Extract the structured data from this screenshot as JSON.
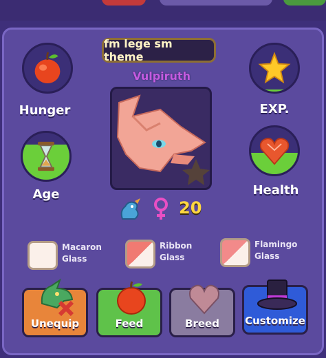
{
  "header": {
    "title": "fm lege sm theme"
  },
  "pet": {
    "name": "Vulpiruth",
    "age_value": "20"
  },
  "stats": {
    "hunger": {
      "label": "Hunger",
      "icon": "apple-icon",
      "level": 0
    },
    "exp": {
      "label": "EXP.",
      "icon": "star-icon",
      "level": 0.05
    },
    "age": {
      "label": "Age",
      "icon": "hourglass-icon",
      "level": 0.75
    },
    "health": {
      "label": "Health",
      "icon": "heart-icon",
      "level": 0.45
    }
  },
  "glasses": [
    {
      "line1": "Macaron",
      "line2": "Glass",
      "checked": false
    },
    {
      "line1": "Ribbon",
      "line2": "Glass",
      "checked": true
    },
    {
      "line1": "Flamingo",
      "line2": "Glass",
      "checked": true
    }
  ],
  "actions": {
    "unequip": {
      "label": "Unequip",
      "color": "#e8853a"
    },
    "feed": {
      "label": "Feed",
      "color": "#5fc24a"
    },
    "breed": {
      "label": "Breed",
      "color": "#8a7ca0"
    },
    "customize": {
      "label": "Customize",
      "color": "#2f5bd8"
    }
  },
  "colors": {
    "panel": "#5b4a9e",
    "name": "#c45be0",
    "age_number": "#ffd740",
    "female_symbol": "#e94fc4",
    "stat_fill": "#6bcf3a"
  }
}
